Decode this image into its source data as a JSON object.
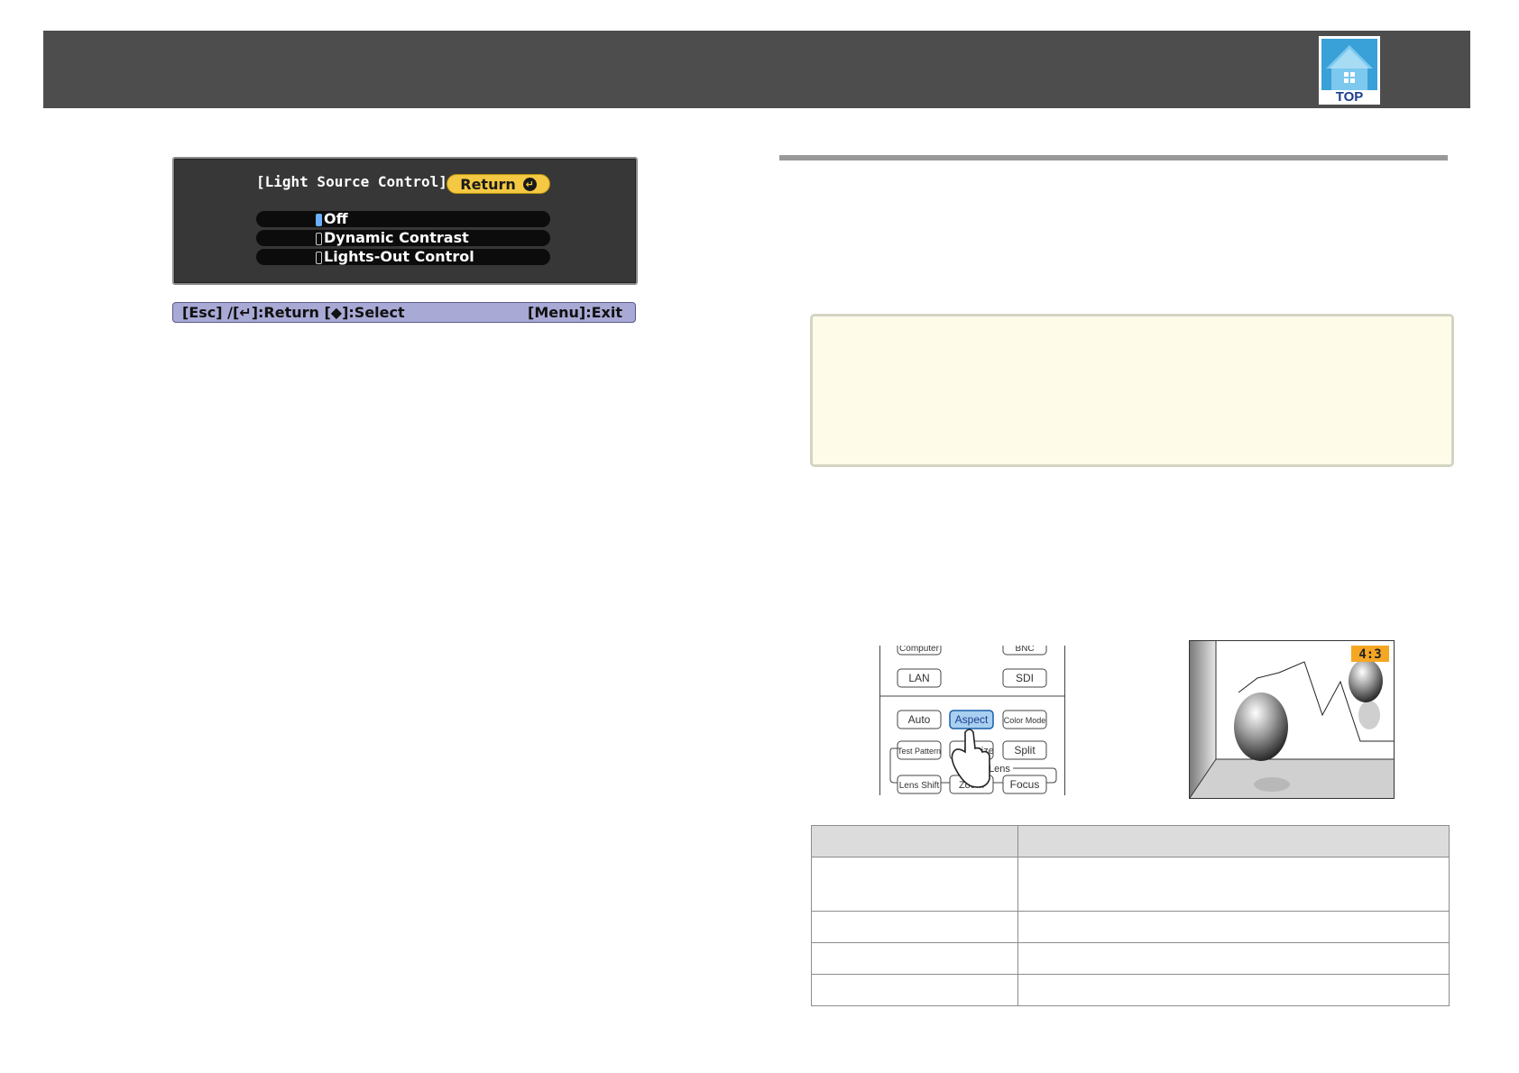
{
  "header": {
    "logo_text": "TOP"
  },
  "osd": {
    "title": "[Light Source Control]",
    "return_label": "Return",
    "options": [
      {
        "label": "Off",
        "selected": true
      },
      {
        "label": "Dynamic Contrast",
        "selected": false
      },
      {
        "label": "Lights-Out Control",
        "selected": false
      }
    ],
    "status_left": "[Esc] /[↵]:Return  [◆]:Select",
    "status_right": "[Menu]:Exit"
  },
  "remote": {
    "buttons": [
      "Computer",
      "BNC",
      "LAN",
      "SDI",
      "Auto",
      "Aspect",
      "Color Mode",
      "Test Pattern",
      "Resize",
      "Split",
      "Lens Shift",
      "Zoom",
      "Focus"
    ],
    "group_label": "Lens",
    "highlighted": "Aspect"
  },
  "screen": {
    "aspect_badge": "4:3"
  },
  "table": {
    "header": [
      "",
      ""
    ],
    "rows": [
      [
        "",
        ""
      ],
      [
        "",
        ""
      ],
      [
        "",
        ""
      ],
      [
        "",
        ""
      ]
    ]
  },
  "colors": {
    "header_bg": "#4d4d4d",
    "osd_bg": "#373737",
    "return_button": "#f4c842",
    "statusbar": "#a9a9d6",
    "note_bg": "#fefbe9",
    "aspect_badge": "#f5a623"
  }
}
